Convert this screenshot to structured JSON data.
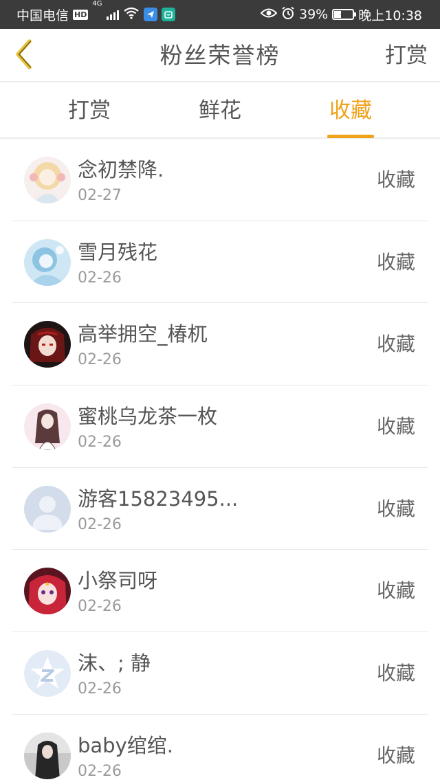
{
  "status_bar": {
    "carrier": "中国电信",
    "hd": "HD",
    "network": "4G",
    "battery_percent": "39%",
    "battery_level": 0.39,
    "time": "晚上10:38",
    "icons": [
      "wifi-icon",
      "app-notification-icon",
      "mi-app-icon",
      "eye-icon",
      "alarm-icon",
      "battery-icon"
    ]
  },
  "header": {
    "back_icon": "chevron-left-icon",
    "title": "粉丝荣誉榜",
    "action_label": "打赏"
  },
  "tabs": [
    {
      "label": "打赏",
      "active": false
    },
    {
      "label": "鲜花",
      "active": false
    },
    {
      "label": "收藏",
      "active": true
    }
  ],
  "colors": {
    "accent": "#f0a21a",
    "text": "#555555",
    "subtext": "#9a9a9a",
    "divider": "#e6e6e6",
    "statusbar": "#3b3b3b"
  },
  "fans": [
    {
      "name": "念初禁降.",
      "date": "02-27",
      "action": "收藏",
      "avatar": "anime-girl-avatar"
    },
    {
      "name": "雪月残花",
      "date": "02-26",
      "action": "收藏",
      "avatar": "anime-blue-avatar"
    },
    {
      "name": "高举拥空_椿杌",
      "date": "02-26",
      "action": "收藏",
      "avatar": "anime-red-avatar"
    },
    {
      "name": "蜜桃乌龙茶一枚",
      "date": "02-26",
      "action": "收藏",
      "avatar": "anime-sketch-avatar"
    },
    {
      "name": "游客15823495...",
      "date": "02-26",
      "action": "收藏",
      "avatar": "default-user-avatar"
    },
    {
      "name": "小祭司呀",
      "date": "02-26",
      "action": "收藏",
      "avatar": "anime-pink-avatar"
    },
    {
      "name": "沫、; 静",
      "date": "02-26",
      "action": "收藏",
      "avatar": "qq-default-avatar"
    },
    {
      "name": "baby绾绾.",
      "date": "02-26",
      "action": "收藏",
      "avatar": "photo-avatar"
    }
  ]
}
